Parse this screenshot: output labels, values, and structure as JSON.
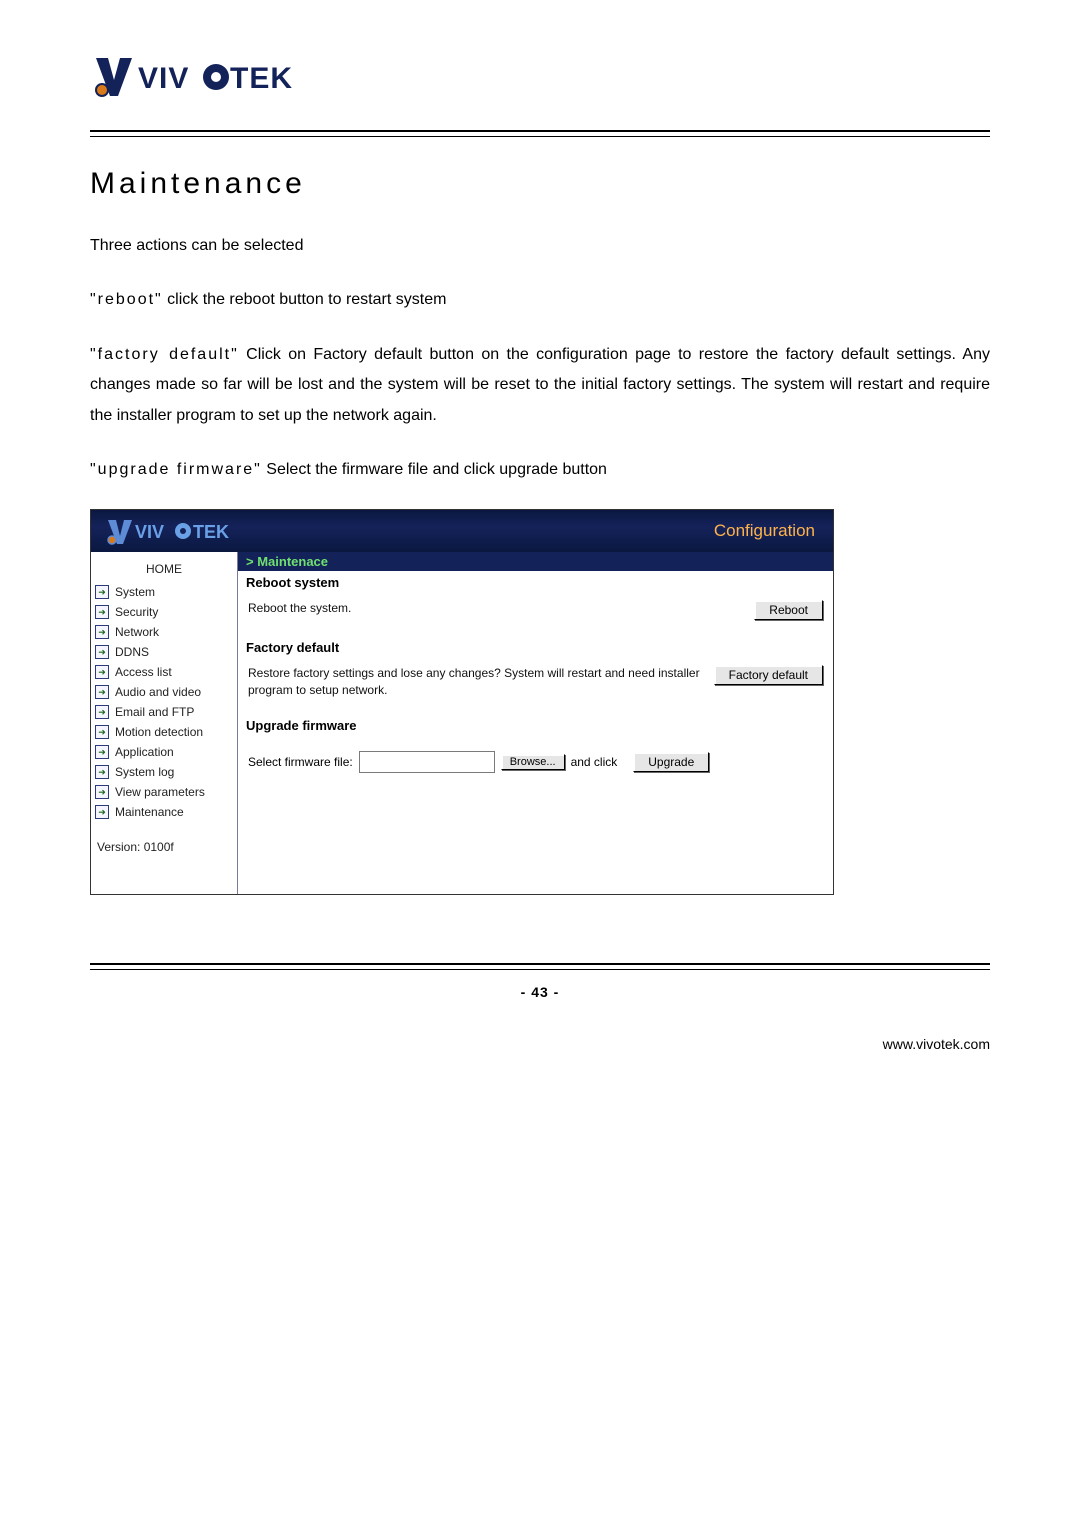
{
  "brand": "VIVOTEK",
  "doc": {
    "title": "Maintenance",
    "intro": "Three actions can be selected",
    "para_reboot_kw": "\"reboot\"",
    "para_reboot_rest": " click the reboot button to restart system",
    "para_factory_kw": "\"factory default\"",
    "para_factory_rest": " Click on Factory default button on the configuration page to restore the factory default settings. Any changes made so far will be lost and the system will be reset to the initial factory settings. The system will restart and require the installer program to set up the network again.",
    "para_upgrade_kw": "\"upgrade firmware\"",
    "para_upgrade_rest": " Select the firmware file and click upgrade button"
  },
  "shot": {
    "config_label": "Configuration",
    "home": "HOME",
    "nav": [
      "System",
      "Security",
      "Network",
      "DDNS",
      "Access list",
      "Audio and video",
      "Email and FTP",
      "Motion detection",
      "Application",
      "System log",
      "View parameters",
      "Maintenance"
    ],
    "version": "Version: 0100f",
    "crumb": "> Maintenace",
    "sec_reboot_title": "Reboot system",
    "sec_reboot_text": "Reboot the system.",
    "btn_reboot": "Reboot",
    "sec_factory_title": "Factory default",
    "sec_factory_text": "Restore factory settings and lose any changes? System will restart and need installer program to setup network.",
    "btn_factory": "Factory default",
    "sec_upgrade_title": "Upgrade firmware",
    "fw_label": "Select firmware file:",
    "btn_browse": "Browse...",
    "fw_and_click": "and click",
    "btn_upgrade": "Upgrade"
  },
  "footer": {
    "page_num": "- 43 -",
    "url": "www.vivotek.com"
  }
}
